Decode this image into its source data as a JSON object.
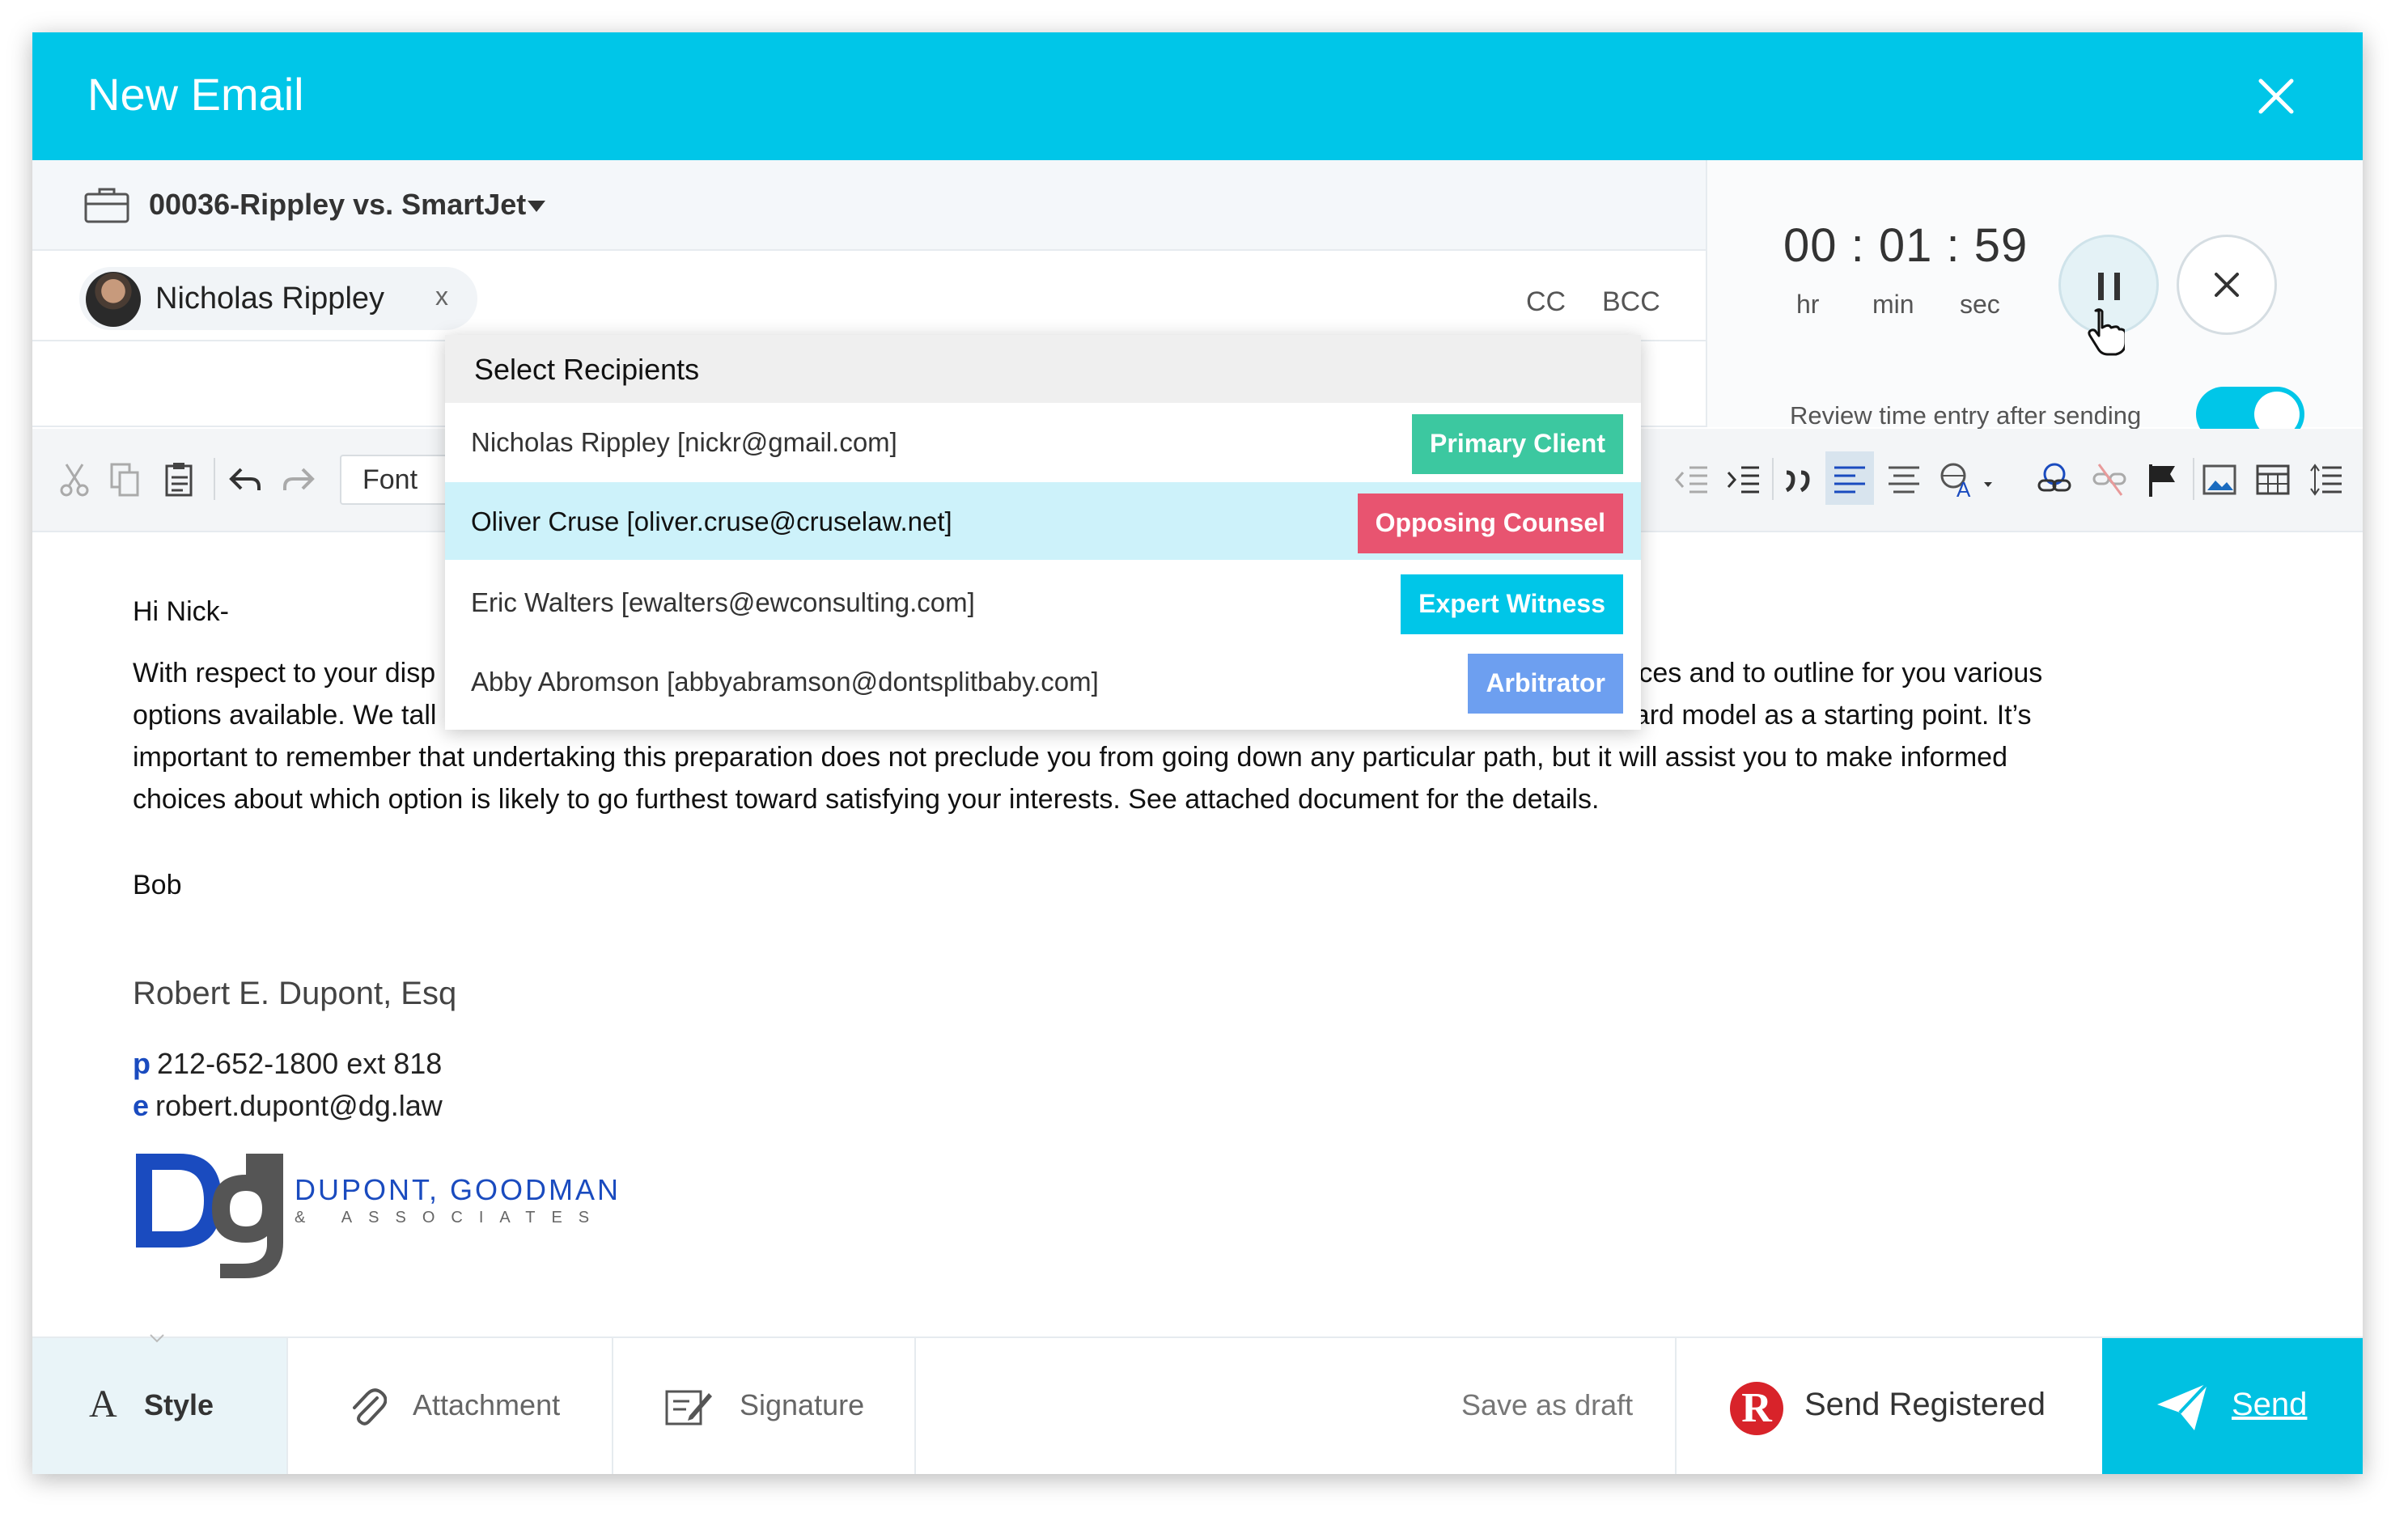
{
  "window": {
    "title": "New Email"
  },
  "matter": {
    "name": "00036-Rippley vs. SmartJet"
  },
  "recipient_chip": {
    "name": "Nicholas Rippley",
    "remove": "x"
  },
  "recipient_row": {
    "cc": "CC",
    "bcc": "BCC"
  },
  "timer": {
    "hours": "00",
    "minutes": "01",
    "seconds": "59",
    "separator": ":",
    "hr_label": "hr",
    "min_label": "min",
    "sec_label": "sec",
    "review_label": "Review time entry after sending",
    "review_enabled": true
  },
  "toolbar": {
    "font_label": "Font"
  },
  "dropdown": {
    "header": "Select Recipients",
    "items": [
      {
        "text": "Nicholas Rippley [nickr@gmail.com]",
        "tag": "Primary Client",
        "tag_color": "#3cc8a0",
        "selected": false
      },
      {
        "text": "Oliver Cruse [oliver.cruse@cruselaw.net]",
        "tag": "Opposing Counsel",
        "tag_color": "#e85470",
        "selected": true
      },
      {
        "text": "Eric Walters [ewalters@ewconsulting.com]",
        "tag": "Expert Witness",
        "tag_color": "#00c6e8",
        "selected": false
      },
      {
        "text": "Abby Abromson [abbyabramson@dontsplitbaby.com]",
        "tag": "Arbitrator",
        "tag_color": "#6d9ff0",
        "selected": false
      }
    ]
  },
  "body": {
    "greeting": "Hi Nick-",
    "lines": [
      [
        "With respect to your disp",
        "nstances and to outline for you various"
      ],
      [
        "options available. We tall",
        "rvard model as a starting point. It’s"
      ],
      [
        "important to remember that undertaking this preparation does not preclude you from going down any particular path, but it will assist you to make informed"
      ],
      [
        "choices about which option is likely to go furthest toward satisfying your interests.  See attached document for the details."
      ]
    ],
    "signoff": "Bob"
  },
  "signature": {
    "name": "Robert E. Dupont, Esq",
    "phone_prefix": "p",
    "phone": "212-652-1800 ext 818",
    "email_prefix": "e",
    "email": "robert.dupont@dg.law",
    "logo_text": "DUPONT, GOODMAN",
    "logo_sub": "& ASSOCIATES"
  },
  "bottom": {
    "style": "Style",
    "attachment": "Attachment",
    "signature": "Signature",
    "save_draft": "Save as draft",
    "send_registered": "Send Registered",
    "send": "Send"
  },
  "colors": {
    "accent": "#00c6e8",
    "send": "#00c1e2",
    "brand_blue": "#1a4bbf",
    "registered_red": "#d8232a"
  }
}
